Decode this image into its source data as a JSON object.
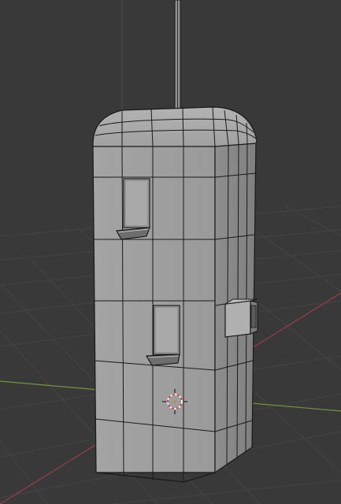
{
  "viewport": {
    "background": "#3a3a3a",
    "grid_color": "#474747",
    "x_axis_color": "#a0414c",
    "y_axis_color": "#6f9a3c",
    "z_axis_color": "#5a6a82"
  },
  "model": {
    "face_color": "#9a9a9a",
    "face_light": "#a6a6a6",
    "face_dark": "#888888",
    "edge_color": "#1c1c1c"
  },
  "icons": {
    "cursor": "3d-cursor-icon"
  }
}
